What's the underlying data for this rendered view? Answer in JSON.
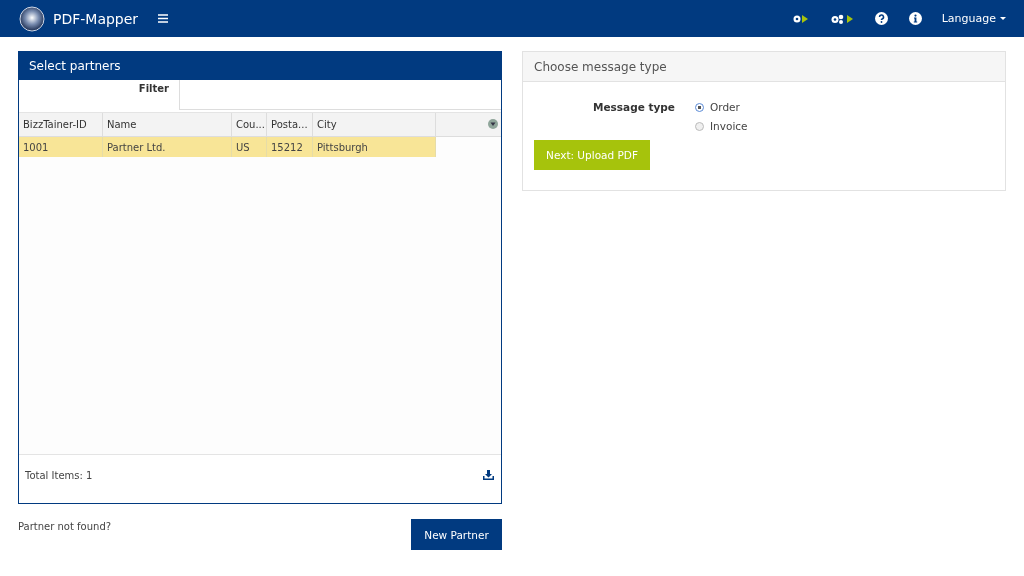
{
  "navbar": {
    "title": "PDF-Mapper",
    "language": "Language"
  },
  "partners": {
    "title": "Select partners",
    "filter_label": "Filter",
    "columns": [
      "BizzTainer-ID",
      "Name",
      "Cou...",
      "Posta...",
      "City"
    ],
    "rows": [
      {
        "cells": [
          "1001",
          "Partner Ltd.",
          "US",
          "15212",
          "Pittsburgh"
        ],
        "selected": true
      }
    ],
    "total": "Total Items: 1"
  },
  "partner_not_found": "Partner not found?",
  "new_partner_button": "New Partner",
  "message_panel": {
    "title": "Choose message type",
    "field_label": "Message type",
    "options": [
      {
        "label": "Order",
        "selected": true
      },
      {
        "label": "Invoice",
        "selected": false
      }
    ],
    "next_button": "Next: Upload PDF"
  }
}
